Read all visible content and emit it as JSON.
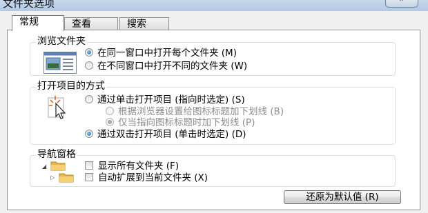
{
  "window": {
    "title": "文件夹选项"
  },
  "tabs": [
    {
      "label": "常规",
      "active": true
    },
    {
      "label": "查看",
      "active": false
    },
    {
      "label": "搜索",
      "active": false
    }
  ],
  "browse_group": {
    "label": "浏览文件夹",
    "options": [
      {
        "label": "在同一窗口中打开每个文件夹 (M)",
        "selected": true
      },
      {
        "label": "在不同窗口中打开不同的文件夹 (W)",
        "selected": false
      }
    ]
  },
  "click_group": {
    "label": "打开项目的方式",
    "options": [
      {
        "label": "通过单击打开项目 (指向时选定) (S)",
        "selected": false,
        "enabled": true
      },
      {
        "label": "根据浏览器设置给图标标题加下划线 (B)",
        "selected": false,
        "enabled": false
      },
      {
        "label": "仅当指向图标标题时加下划线 (P)",
        "selected": true,
        "enabled": false
      },
      {
        "label": "通过双击打开项目 (单击时选定) (D)",
        "selected": true,
        "enabled": true
      }
    ]
  },
  "nav_group": {
    "label": "导航窗格",
    "options": [
      {
        "label": "显示所有文件夹 (F)",
        "checked": false
      },
      {
        "label": "自动扩展到当前文件夹 (X)",
        "checked": false
      }
    ]
  },
  "restore_button": {
    "label": "还原为默认值 (R)"
  },
  "colors": {
    "accent": "#1b64b6",
    "group_border": "#d5dfe5",
    "folder": "#e8b54a"
  }
}
